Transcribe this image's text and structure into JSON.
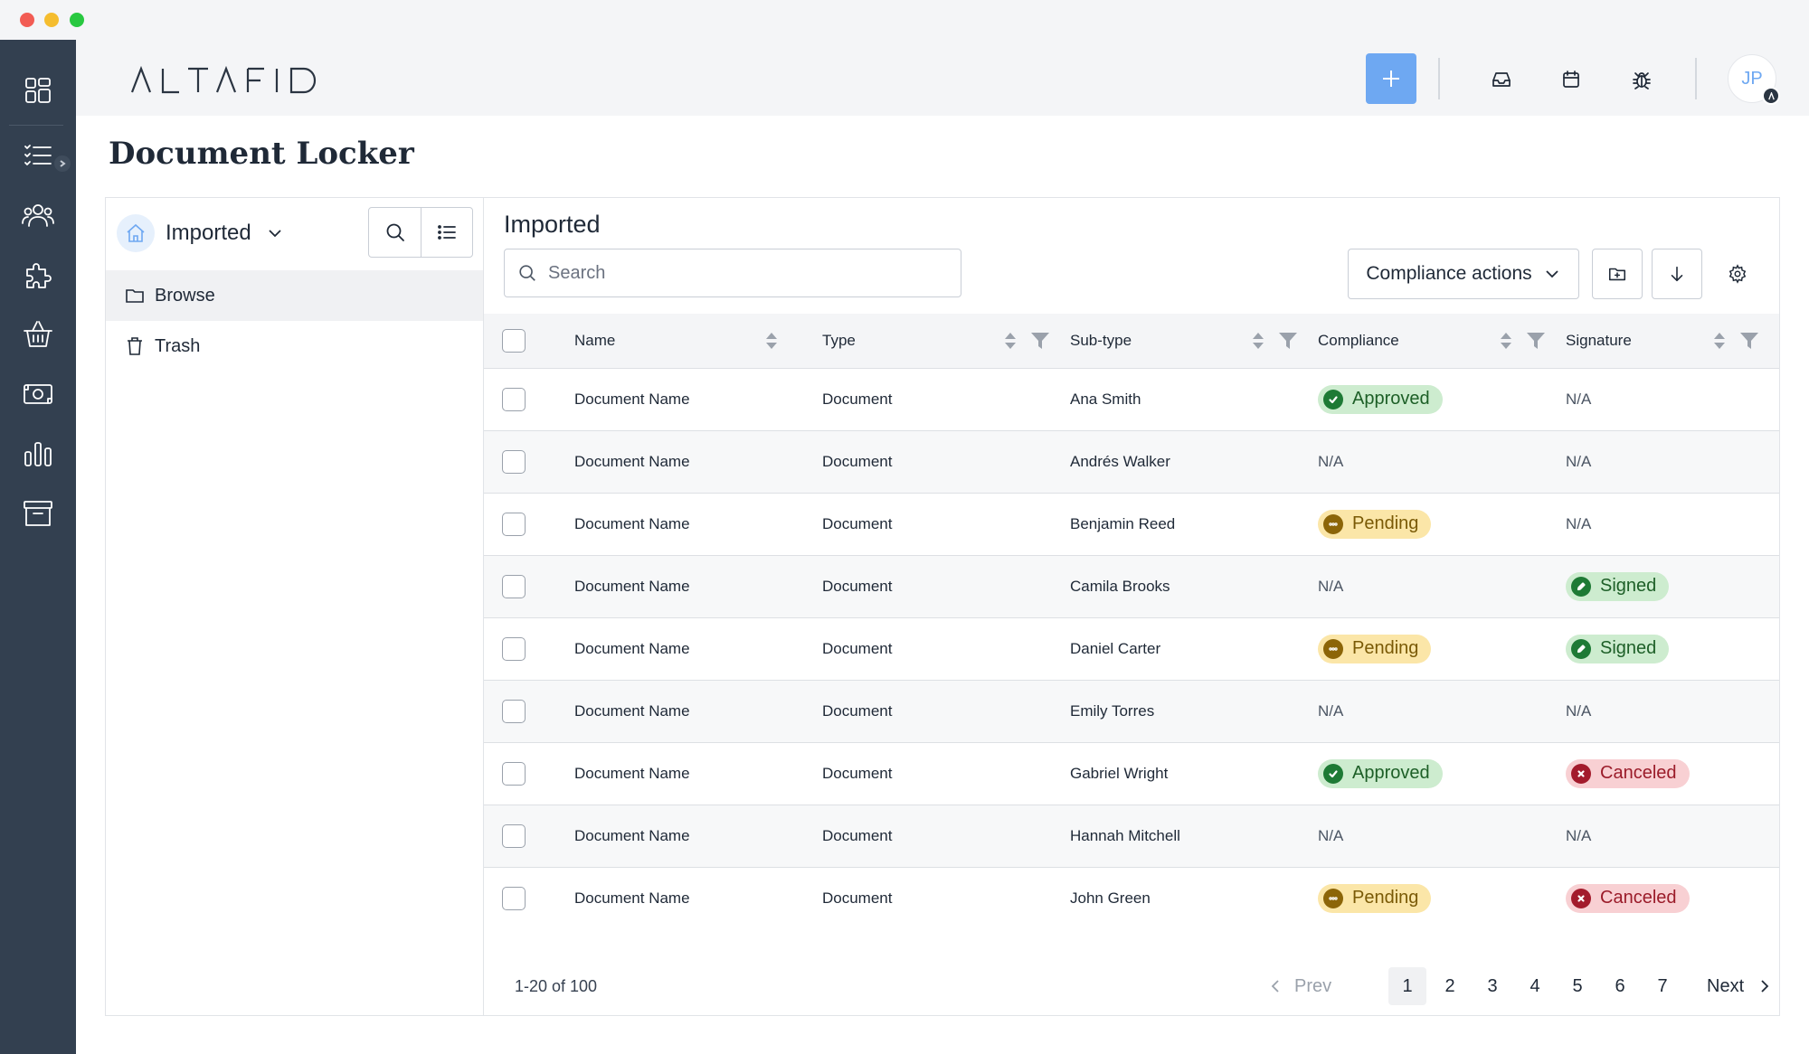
{
  "window": {
    "controls": [
      "close",
      "minimize",
      "maximize"
    ]
  },
  "rail": {
    "items": [
      {
        "icon": "dashboard-grid-icon"
      },
      {
        "icon": "task-list-icon"
      },
      {
        "icon": "people-icon"
      },
      {
        "icon": "puzzle-icon"
      },
      {
        "icon": "basket-icon"
      },
      {
        "icon": "money-icon"
      },
      {
        "icon": "bar-chart-icon"
      },
      {
        "icon": "archive-icon"
      }
    ]
  },
  "header": {
    "logo_text": "ALTAFID",
    "add_button_icon": "plus-icon",
    "icons": [
      "inbox-icon",
      "calendar-icon",
      "bug-icon"
    ],
    "avatar_initials": "JP",
    "accent_color": "#6ea8f2"
  },
  "page": {
    "title": "Document Locker"
  },
  "left_pane": {
    "folder_label": "Imported",
    "tree": [
      {
        "label": "Browse",
        "icon": "folder-icon",
        "active": true
      },
      {
        "label": "Trash",
        "icon": "trash-icon",
        "active": false
      }
    ]
  },
  "right_pane": {
    "title": "Imported",
    "search_placeholder": "Search",
    "compliance_actions_label": "Compliance actions",
    "columns": [
      "Name",
      "Type",
      "Sub-type",
      "Compliance",
      "Signature"
    ],
    "rows": [
      {
        "name": "Document Name",
        "type": "Document",
        "subtype": "Ana Smith",
        "compliance": "Approved",
        "signature": "N/A"
      },
      {
        "name": "Document Name",
        "type": "Document",
        "subtype": "Andrés Walker",
        "compliance": "N/A",
        "signature": "N/A"
      },
      {
        "name": "Document Name",
        "type": "Document",
        "subtype": "Benjamin Reed",
        "compliance": "Pending",
        "signature": "N/A"
      },
      {
        "name": "Document Name",
        "type": "Document",
        "subtype": "Camila Brooks",
        "compliance": "N/A",
        "signature": "Signed"
      },
      {
        "name": "Document Name",
        "type": "Document",
        "subtype": "Daniel Carter",
        "compliance": "Pending",
        "signature": "Signed"
      },
      {
        "name": "Document Name",
        "type": "Document",
        "subtype": "Emily Torres",
        "compliance": "N/A",
        "signature": "N/A"
      },
      {
        "name": "Document Name",
        "type": "Document",
        "subtype": "Gabriel Wright",
        "compliance": "Approved",
        "signature": "Canceled"
      },
      {
        "name": "Document Name",
        "type": "Document",
        "subtype": "Hannah Mitchell",
        "compliance": "N/A",
        "signature": "N/A"
      },
      {
        "name": "Document Name",
        "type": "Document",
        "subtype": "John Green",
        "compliance": "Pending",
        "signature": "Canceled"
      }
    ],
    "pagination": {
      "count_label": "1-20 of 100",
      "prev_label": "Prev",
      "next_label": "Next",
      "pages": [
        "1",
        "2",
        "3",
        "4",
        "5",
        "6",
        "7"
      ],
      "current_page": "1"
    }
  },
  "status_colors": {
    "approved": "#1e7a35",
    "pending": "#8c6508",
    "signed": "#1e7a35",
    "canceled": "#a31b2c"
  }
}
